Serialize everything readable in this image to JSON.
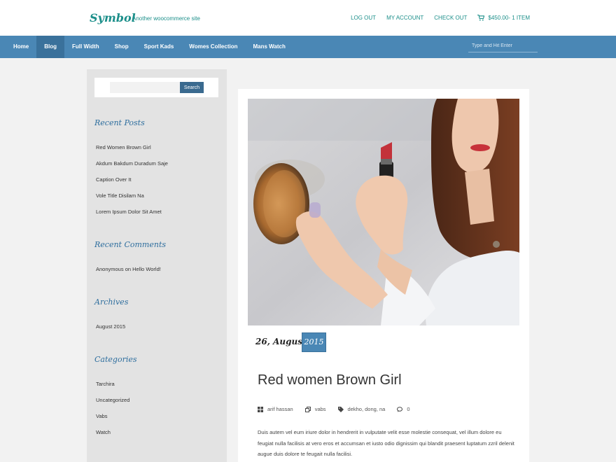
{
  "header": {
    "logo": "Symbol",
    "tagline": "Another woocommerce site",
    "links": [
      "LOG OUT",
      "MY ACCOUNT",
      "CHECK OUT"
    ],
    "cart_text": "$450.00- 1 ITEM",
    "accent_color": "#1c8f8a"
  },
  "nav": {
    "items": [
      "Home",
      "Blog",
      "Full Width",
      "Shop",
      "Sport Kads",
      "Womes Collection",
      "Mans Watch"
    ],
    "active": "Blog",
    "search_placeholder": "Type and Hit Enter",
    "bar_color": "#4a87b5"
  },
  "sidebar": {
    "search_button": "Search",
    "recent_posts": {
      "title": "Recent Posts",
      "items": [
        "Red Women Brown Girl",
        "Akdum Bakdum Duradum Saje",
        "Caption Over It",
        "Vole Title Disilam Na",
        "Lorem Ipsum Dolor Sit Amet"
      ]
    },
    "recent_comments": {
      "title": "Recent Comments",
      "author": "Anonymous",
      "on": "on",
      "post": "Hello World!"
    },
    "archives": {
      "title": "Archives",
      "items": [
        "August 2015"
      ]
    },
    "categories": {
      "title": "Categories",
      "items": [
        "Tarchira",
        "Uncategorized",
        "Vabs",
        "Watch"
      ]
    }
  },
  "post": {
    "date_day": "26, August",
    "date_year": "2015",
    "title": "Red women Brown Girl",
    "meta": {
      "author": "arif hassan",
      "category": "vabs",
      "tags": "dekho, dong, na",
      "comments": "0"
    },
    "excerpt": "Duis autem vel eum iriure dolor in hendrerit in vulputate velit esse molestie consequat, vel illum dolore eu feugiat nulla facilisis at vero eros et accumsan et iusto odio dignissim qui blandit praesent luptatum zzril delenit augue duis dolore te feugait nulla facilisi."
  }
}
